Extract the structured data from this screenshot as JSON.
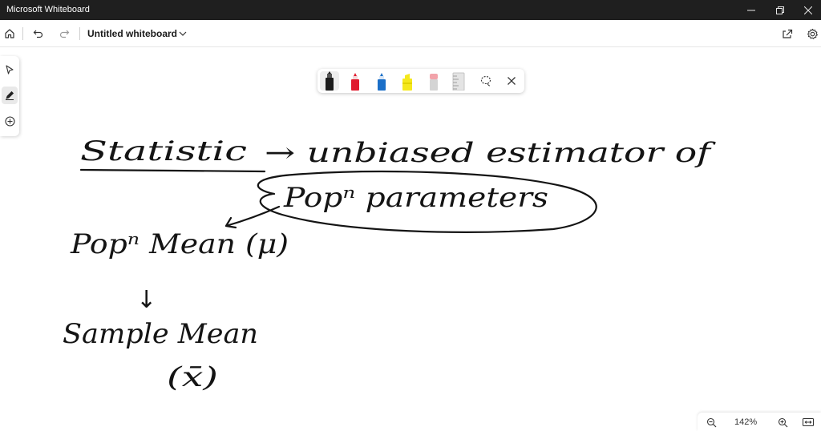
{
  "window": {
    "app_title": "Microsoft Whiteboard"
  },
  "toolbar": {
    "document_title": "Untitled whiteboard"
  },
  "icons": {
    "home": "home-icon",
    "undo": "undo-icon",
    "redo": "redo-icon",
    "title_menu": "chevron-down-icon",
    "share": "share-icon",
    "settings": "gear-icon",
    "select": "select-arrow-icon",
    "inking": "pen-icon",
    "add": "add-circle-icon",
    "lasso": "lasso-icon",
    "close": "close-icon",
    "zoom_out": "zoom-out-icon",
    "zoom_in": "zoom-in-icon",
    "fit": "fit-to-screen-icon"
  },
  "pen_palette": {
    "pens": [
      {
        "name": "black-pen",
        "color": "#1a1a1a"
      },
      {
        "name": "red-pen",
        "color": "#e0192d"
      },
      {
        "name": "blue-pen",
        "color": "#1b6fc8"
      },
      {
        "name": "yellow-highlighter",
        "color": "#f5e81c"
      },
      {
        "name": "eraser",
        "color": "#f2a3aa"
      },
      {
        "name": "ruler",
        "color": "#d6d6d6"
      }
    ],
    "selected": "black-pen"
  },
  "canvas": {
    "handwriting": [
      "Statistic",
      "→ unbiased estimator of",
      "Popⁿ parameters",
      "Popⁿ Mean (μ)",
      "↓",
      "Sample Mean",
      "(x̄)"
    ]
  },
  "zoom": {
    "level": "142%"
  }
}
